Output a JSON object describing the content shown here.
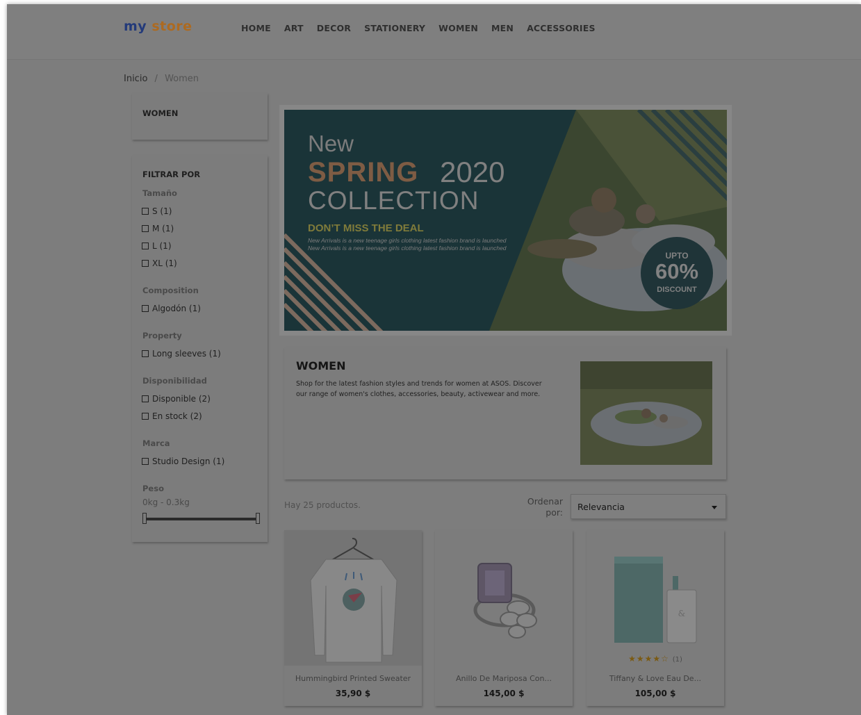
{
  "logo": {
    "part1": "my",
    "part2": "store"
  },
  "nav": [
    "HOME",
    "ART",
    "DECOR",
    "STATIONERY",
    "WOMEN",
    "MEN",
    "ACCESSORIES"
  ],
  "breadcrumb": {
    "home": "Inicio",
    "separator": "/",
    "current": "Women"
  },
  "sidebar": {
    "category_title": "WOMEN",
    "filter_title": "FILTRAR POR",
    "groups": [
      {
        "title": "Tamaño",
        "options": [
          "S (1)",
          "M (1)",
          "L (1)",
          "XL (1)"
        ]
      },
      {
        "title": "Composition",
        "options": [
          "Algodón (1)"
        ]
      },
      {
        "title": "Property",
        "options": [
          "Long sleeves (1)"
        ]
      },
      {
        "title": "Disponibilidad",
        "options": [
          "Disponible (2)",
          "En stock (2)"
        ]
      },
      {
        "title": "Marca",
        "options": [
          "Studio Design (1)"
        ]
      },
      {
        "title": "Peso",
        "options": []
      }
    ],
    "weight_range": "0kg - 0.3kg"
  },
  "banner": {
    "line1": "New",
    "line2a": "SPRING",
    "line2b": "2020",
    "line3": "COLLECTION",
    "deal": "DON’T MISS THE DEAL",
    "text": "New Arrivals is a new teenage girls clothing latest fashion brand is launched New Arrivals is a new teenage girls clothing latest fashion brand is launched",
    "badge_top": "UPTO",
    "badge_pct": "60%",
    "badge_bottom": "DISCOUNT"
  },
  "category": {
    "title": "WOMEN",
    "description": "Shop for the latest fashion styles and trends for women at ASOS. Discover our range of women's clothes, accessories, beauty, activewear and more."
  },
  "listing": {
    "count_text": "Hay 25 productos.",
    "sort_label": "Ordenar por:",
    "sort_value": "Relevancia"
  },
  "products": [
    {
      "name": "Hummingbird Printed Sweater",
      "price": "35,90 $"
    },
    {
      "name": "Anillo De Mariposa Con...",
      "price": "145,00 $"
    },
    {
      "name": "Tiffany & Love Eau De...",
      "price": "105,00 $",
      "stars": "★★★★☆",
      "reviews": "(1)"
    }
  ],
  "colors": {
    "overlay": "#7d7d7d",
    "banner_bg": "#1a3438",
    "accent": "#7e5c44"
  }
}
